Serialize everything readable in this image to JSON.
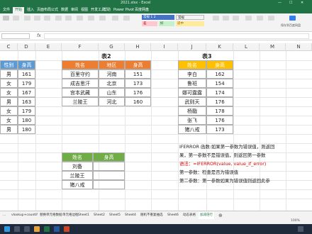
{
  "window": {
    "title": "2021.xlsx - Excel",
    "min": "—",
    "max": "☐",
    "close": "✕"
  },
  "ribbon_tabs": [
    "文件",
    "开始",
    "插入",
    "页面布局",
    "公式",
    "数据",
    "审阅",
    "视图",
    "开发工具",
    "帮助",
    "Power Pivot",
    "百度网盘"
  ],
  "ribbon": {
    "styles": [
      {
        "label": "常规 1 2",
        "bg": "#ffffff"
      },
      {
        "label": "常规",
        "bg": "#ffffff"
      },
      {
        "label": "差",
        "bg": "#ffc7ce"
      },
      {
        "label": "好",
        "bg": "#c6efce"
      },
      {
        "label": "适中",
        "bg": "#ffeb9c"
      }
    ],
    "right_label": "保存到百度网盘"
  },
  "formula_bar": {
    "name_box": "",
    "fx": "fx"
  },
  "columns": [
    "C",
    "D",
    "E",
    "F",
    "G",
    "H",
    "I",
    "J",
    "K",
    "L",
    "M",
    "N"
  ],
  "table_left": {
    "headers": [
      "性别",
      "身高"
    ],
    "rows": [
      [
        "男",
        "161"
      ],
      [
        "女",
        "179"
      ],
      [
        "女",
        "167"
      ],
      [
        "男",
        "163"
      ],
      [
        "女",
        "179"
      ],
      [
        "女",
        "180"
      ],
      [
        "男",
        "180"
      ]
    ]
  },
  "table2": {
    "title": "表2",
    "headers": [
      "姓名",
      "地区",
      "身高"
    ],
    "rows": [
      [
        "百里守约",
        "河南",
        "151"
      ],
      [
        "成吉思汗",
        "北京",
        "173"
      ],
      [
        "宫本武藏",
        "山东",
        "176"
      ],
      [
        "兰陵王",
        "河北",
        "160"
      ]
    ]
  },
  "table3": {
    "title": "表3",
    "headers": [
      "姓名",
      "身高"
    ],
    "rows": [
      [
        "李白",
        "162"
      ],
      [
        "鲁班",
        "154"
      ],
      [
        "娜可露露",
        "174"
      ],
      [
        "武则天",
        "176"
      ],
      [
        "杨戬",
        "178"
      ],
      [
        "张飞",
        "176"
      ],
      [
        "猪八戒",
        "173"
      ]
    ]
  },
  "lookup_table": {
    "headers": [
      "姓名",
      "身高"
    ],
    "rows": [
      [
        "刘备",
        ""
      ],
      [
        "兰陵王",
        ""
      ],
      [
        "猪八戒",
        ""
      ]
    ]
  },
  "notes": {
    "line1": "IFERROR 函数:如果第一参数为错误值，则返回",
    "line2": "果，第一参数不是错误值，则返回第一参数",
    "line3": "语法：=IFERROR(value, value_if_error)",
    "line4": "第一参数：检查是否为错误值",
    "line5": "第二参数：第一参数如果为错误值则返回此参"
  },
  "sheet_tabs": [
    "...",
    "vlookup+countif",
    "替换单元格数据",
    "单元格边框",
    "Sheet1",
    "Sheet2",
    "Sheet5",
    "Sheet4",
    "随机不重复抽选",
    "Sheet6",
    "动态表格",
    "加减倍行"
  ],
  "active_sheet": "加减倍行",
  "status": {
    "zoom": "100%"
  }
}
